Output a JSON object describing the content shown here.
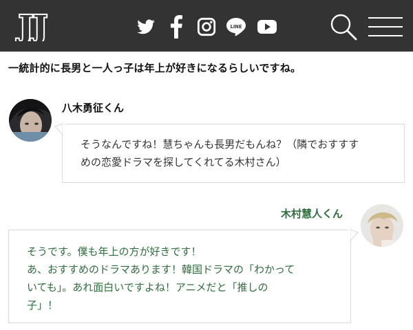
{
  "header": {
    "logo_text": "JJ",
    "social_icons": [
      "twitter-icon",
      "facebook-icon",
      "instagram-icon",
      "line-icon",
      "youtube-icon"
    ],
    "line_label": "LINE",
    "background": "#333333"
  },
  "intro": {
    "text": "一統計的に長男と一人っ子は年上が好きになるらしいですね。"
  },
  "dialogue": [
    {
      "speaker": "八木勇征くん",
      "text": "そうなんですね！慧ちゃんも長男だもんね？（隣でおすすめの恋愛ドラマを探してくれてる木村さん）",
      "color": "#333333"
    },
    {
      "speaker": "木村慧人くん",
      "text": "そうです。僕も年上の方が好きです！あ、おすすめのドラマあります！韓国ドラマの「わかっていても」。あれ面白いですよね！アニメだと「推しの子」！",
      "color": "#2e6e3c"
    }
  ],
  "lines": {
    "msg1": [
      "そうなんですね！慧ちゃんも長男だもんね？（隣でおすすす",
      "めの恋愛ドラマを探してくれてる木村さん）"
    ],
    "msg2": [
      "そうです。僕も年上の方が好きです！",
      "あ、おすすめのドラマあります！韓国ドラマの「わかって",
      "いても」。あれ面白いですよね！アニメだと「推しの",
      "子」！"
    ]
  }
}
